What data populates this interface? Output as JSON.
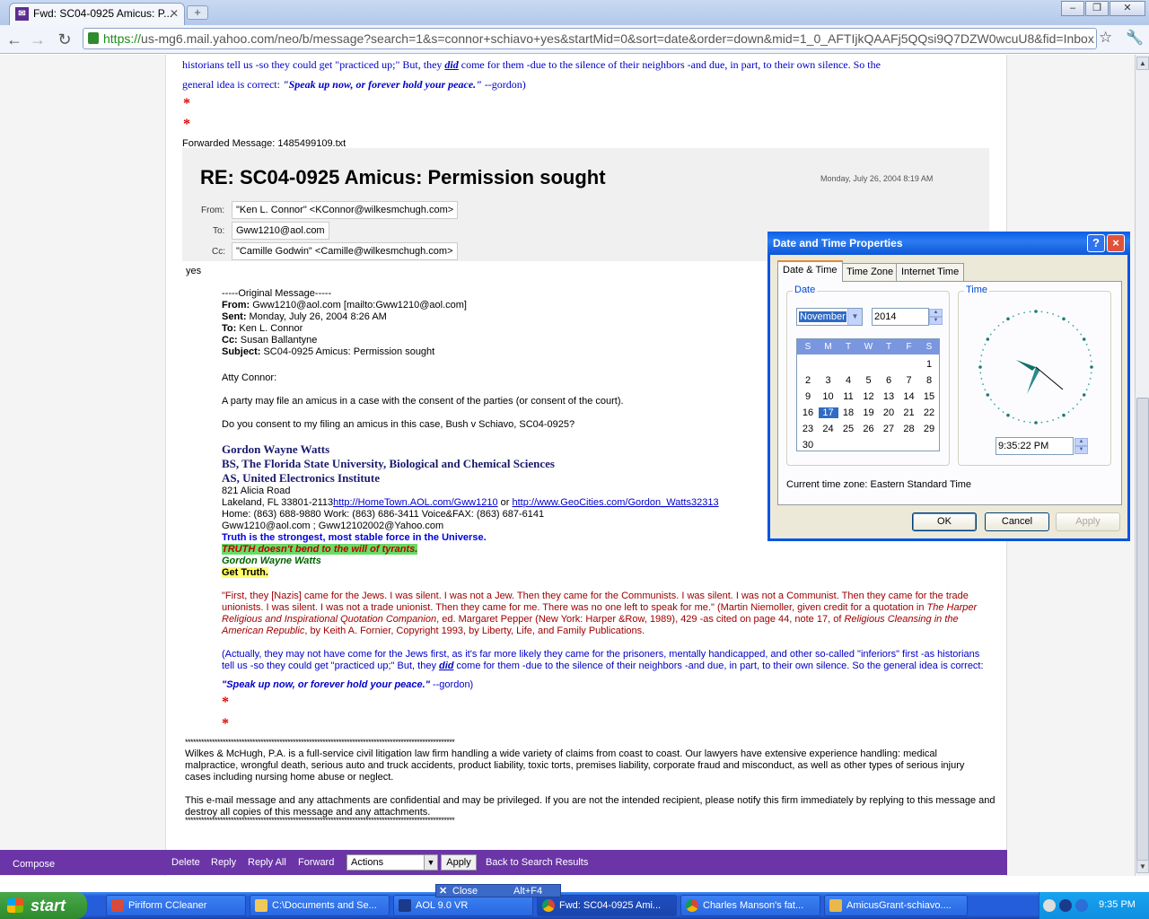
{
  "browser": {
    "tab_title": "Fwd: SC04-0925 Amicus: P...",
    "url_https": "https://",
    "url_rest": "us-mg6.mail.yahoo.com/neo/b/message?search=1&s=connor+schiavo+yes&startMid=0&sort=date&order=down&mid=1_0_AFTIjkQAAFj5QQsi9Q7DZW0wcuU8&fid=Inbox"
  },
  "message": {
    "top_quote_line1": "historians tell us -so they could get \"practiced up;\" But, they ",
    "top_quote_did": "did",
    "top_quote_line1b": " come for them -due to the silence of their neighbors -and due, in part, to their own silence. So the",
    "top_quote_line2a": "general idea is correct: ",
    "top_quote_line2b": "\"Speak up now, or forever hold your peace.\"",
    "top_quote_line2c": " --gordon)",
    "asterisk": "*",
    "forwarded_label": "Forwarded Message: 1485499109.txt",
    "fwd_subject": "RE: SC04-0925 Amicus: Permission sought",
    "fwd_date": "Monday, July 26, 2004 8:19 AM",
    "from_label": "From:",
    "from_value": "\"Ken L. Connor\" <KConnor@wilkesmchugh.com>",
    "to_label": "To:",
    "to_value": "Gww1210@aol.com",
    "cc_label": "Cc:",
    "cc_value": "\"Camille Godwin\" <Camille@wilkesmchugh.com>",
    "reply": "yes",
    "orig_header": "-----Original Message-----",
    "orig_from_label": "From:",
    "orig_from": " Gww1210@aol.com [mailto:Gww1210@aol.com]",
    "orig_sent_label": "Sent:",
    "orig_sent": " Monday, July 26, 2004 8:26 AM",
    "orig_to_label": "To:",
    "orig_to": " Ken L. Connor",
    "orig_cc_label": "Cc:",
    "orig_cc": " Susan Ballantyne",
    "orig_subject_label": "Subject:",
    "orig_subject": " SC04-0925 Amicus: Permission sought",
    "salutation": "Atty Connor:",
    "para1": "A party may file an amicus in a case with the consent of the parties (or consent of the court).",
    "para2": "Do you consent to my filing an amicus in this case, Bush v Schiavo, SC04-0925?",
    "sig_name": "Gordon Wayne Watts",
    "sig_bs": "BS, The Florida State University, Biological and Chemical Sciences",
    "sig_as": "AS, United Electronics Institute",
    "sig_addr1": "821 Alicia Road",
    "sig_addr2a": "Lakeland, FL 33801-2113",
    "sig_link1": "http://HomeTown.AOL.com/Gww1210",
    "sig_or": " or ",
    "sig_link2": "http://www.GeoCities.com/Gordon_Watts32313",
    "sig_phone": "Home: (863) 688-9880 Work: (863) 686-3411 Voice&FAX: (863) 687-6141",
    "sig_emails": "Gww1210@aol.com ; Gww12102002@Yahoo.com",
    "sig_truth1": "Truth is the strongest, most stable force in the Universe.",
    "sig_truth2": "TRUTH doesn't bend to the will of tyrants.",
    "sig_name2": "Gordon Wayne Watts",
    "sig_gettruth": "Get Truth.",
    "quote_l1": "\"First, they [Nazis] came for the Jews. I was silent. I was not a Jew. Then they came for the Communists. I was silent. I was not a Communist. Then they came for the trade",
    "quote_l2a": "unionists. I was silent. I was not a trade unionist. Then they came for me. There was no one left to speak for me.\" (Martin Niemoller, given credit for a quotation in ",
    "quote_l2b": "The Harper",
    "quote_l3a": "Religious and Inspirational Quotation Companion",
    "quote_l3b": ", ed. Margaret Pepper (New York: Harper &Row, 1989), 429 -as cited on page 44, note 17, of ",
    "quote_l3c": "Religious Cleansing in the",
    "quote_l4a": "American Republic",
    "quote_l4b": ", by Keith A. Fornier, Copyright 1993, by Liberty, Life, and Family Publications.",
    "actually_l1": "(Actually, they may not have come for the Jews first, as it's far more likely they came for the prisoners, mentally handicapped, and other so-called \"inferiors\" first -as historians",
    "actually_l2a": "tell us -so they could get \"practiced up;\" But, they ",
    "actually_did": "did",
    "actually_l2b": " come for them -due to the silence of their neighbors -and due, in part, to their own silence. So the general idea is correct:",
    "speakup": "\"Speak up now, or forever hold your peace.\"",
    "speakup_tail": " --gordon)",
    "stars_line": "****************************************************************************************************",
    "wm_l1": "Wilkes & McHugh, P.A. is a full-service civil litigation law firm handling a wide variety of claims from coast to coast. Our lawyers have extensive experience handling: medical",
    "wm_l2": "malpractice, wrongful death, serious auto and truck accidents, product liability, toxic torts, premises liability, corporate fraud and misconduct, as well as other types of serious injury",
    "wm_l3": "cases including nursing home abuse or neglect.",
    "conf_l1": "This e-mail message and any attachments are confidential and may be privileged. If you are not the intended recipient, please notify this firm immediately by replying to this message and",
    "conf_l2": "destroy all copies of this message and any attachments."
  },
  "bottombar": {
    "compose": "Compose",
    "delete": "Delete",
    "reply": "Reply",
    "reply_all": "Reply All",
    "forward": "Forward",
    "actions": "Actions",
    "apply": "Apply",
    "back": "Back to Search Results"
  },
  "dialog": {
    "title": "Date and Time Properties",
    "help": "?",
    "close": "×",
    "tabs": [
      "Date & Time",
      "Time Zone",
      "Internet Time"
    ],
    "date_group": "Date",
    "time_group": "Time",
    "month": "November",
    "year": "2014",
    "weekdays": [
      "S",
      "M",
      "T",
      "W",
      "T",
      "F",
      "S"
    ],
    "days": [
      "1",
      "2",
      "3",
      "4",
      "5",
      "6",
      "7",
      "8",
      "9",
      "10",
      "11",
      "12",
      "13",
      "14",
      "15",
      "16",
      "17",
      "18",
      "19",
      "20",
      "21",
      "22",
      "23",
      "24",
      "25",
      "26",
      "27",
      "28",
      "29",
      "30"
    ],
    "selected_day": 17,
    "time_value": "9:35:22 PM",
    "timezone_label": "Current time zone:  Eastern Standard Time",
    "ok": "OK",
    "cancel": "Cancel",
    "apply": "Apply"
  },
  "context": {
    "close": "Close",
    "shortcut": "Alt+F4"
  },
  "taskbar": {
    "start": "start",
    "tasks": [
      "Piriform CCleaner",
      "C:\\Documents and Se...",
      "AOL 9.0 VR",
      "Fwd: SC04-0925 Ami...",
      "Charles Manson's fat...",
      "AmicusGrant-schiavo...."
    ],
    "clock": "9:35 PM"
  }
}
